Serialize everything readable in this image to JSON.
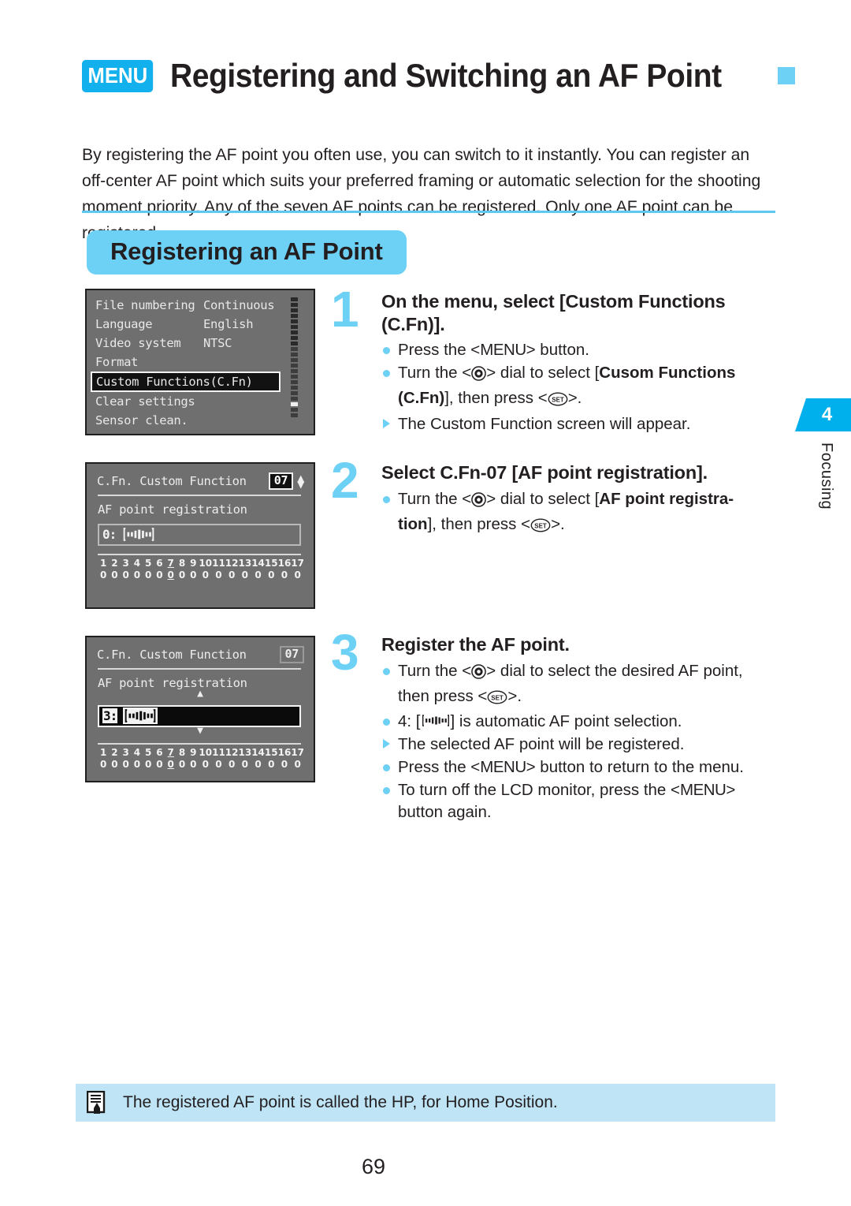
{
  "header": {
    "menu_badge": "MENU",
    "title": "Registering and Switching an AF Point",
    "accent_color": "#6dd0f5",
    "badge_color": "#12b0ec"
  },
  "intro": "By registering the AF point you often use, you can switch to it instantly. You can register an off-center AF point which suits your preferred framing or automatic selection for the shooting moment priority. Any of the seven AF points can be registered. Only one AF point can be registered.",
  "section": {
    "heading": "Registering an AF Point"
  },
  "side_tab": {
    "number": "4",
    "label": "Focusing"
  },
  "lcd_menu": {
    "rows": [
      {
        "label": "File numbering",
        "value": "Continuous",
        "selected": false
      },
      {
        "label": "Language",
        "value": "English",
        "selected": false
      },
      {
        "label": "Video system",
        "value": "NTSC",
        "selected": false
      },
      {
        "label": "Format",
        "value": "",
        "selected": false
      },
      {
        "label": "Custom Functions(C.Fn)",
        "value": "",
        "selected": true
      },
      {
        "label": "Clear settings",
        "value": "",
        "selected": false
      },
      {
        "label": "Sensor clean.",
        "value": "",
        "selected": false
      }
    ]
  },
  "lcd_cfn_1": {
    "title": "C.Fn. Custom Function",
    "number": "07",
    "subtitle": "AF point registration",
    "value_number": "0:",
    "active": false,
    "grid_numbers": [
      "1",
      "2",
      "3",
      "4",
      "5",
      "6",
      "7",
      "8",
      "9",
      "10",
      "11",
      "12",
      "13",
      "14",
      "15",
      "16",
      "17"
    ],
    "grid_values": [
      "0",
      "0",
      "0",
      "0",
      "0",
      "0",
      "0",
      "0",
      "0",
      "0",
      "0",
      "0",
      "0",
      "0",
      "0",
      "0",
      "0"
    ],
    "grid_marked_index": 6
  },
  "lcd_cfn_2": {
    "title": "C.Fn. Custom Function",
    "number": "07",
    "subtitle": "AF point registration",
    "value_number": "3:",
    "active": true,
    "grid_numbers": [
      "1",
      "2",
      "3",
      "4",
      "5",
      "6",
      "7",
      "8",
      "9",
      "10",
      "11",
      "12",
      "13",
      "14",
      "15",
      "16",
      "17"
    ],
    "grid_values": [
      "0",
      "0",
      "0",
      "0",
      "0",
      "0",
      "0",
      "0",
      "0",
      "0",
      "0",
      "0",
      "0",
      "0",
      "0",
      "0",
      "0"
    ],
    "grid_marked_index": 6
  },
  "steps": [
    {
      "number": "1",
      "heading": "On the menu, select [Custom Functions (C.Fn)].",
      "bullets": [
        {
          "type": "dot",
          "html": "Press the &lt;MENU&gt; button."
        },
        {
          "type": "dot",
          "html": "Turn the &lt;DIAL&gt; dial to select [<b>Cusom Functions (C.Fn)</b>], then press &lt;SET&gt;."
        },
        {
          "type": "tri",
          "html": "The Custom Function screen will appear."
        }
      ]
    },
    {
      "number": "2",
      "heading": "Select C.Fn-07 [AF point registration].",
      "bullets": [
        {
          "type": "dot",
          "html": "Turn the &lt;DIAL&gt; dial to select [<b>AF point registra-tion</b>], then press &lt;SET&gt;."
        }
      ]
    },
    {
      "number": "3",
      "heading": "Register the AF point.",
      "bullets": [
        {
          "type": "dot",
          "html": "Turn the &lt;DIAL&gt; dial to select the desired AF point, then press &lt;SET&gt;."
        },
        {
          "type": "dot",
          "html": "4: [AF] is automatic AF point selection."
        },
        {
          "type": "tri",
          "html": "The selected AF point will be registered."
        },
        {
          "type": "dot",
          "html": "Press the &lt;MENU&gt; button to return to the menu."
        },
        {
          "type": "dot",
          "html": "To turn off the LCD monitor, press the &lt;MENU&gt; button again."
        }
      ]
    }
  ],
  "note": {
    "icon": "note-pen-icon",
    "text": "The registered AF point is called the HP, for Home Position."
  },
  "footer": {
    "page_number": "69"
  }
}
